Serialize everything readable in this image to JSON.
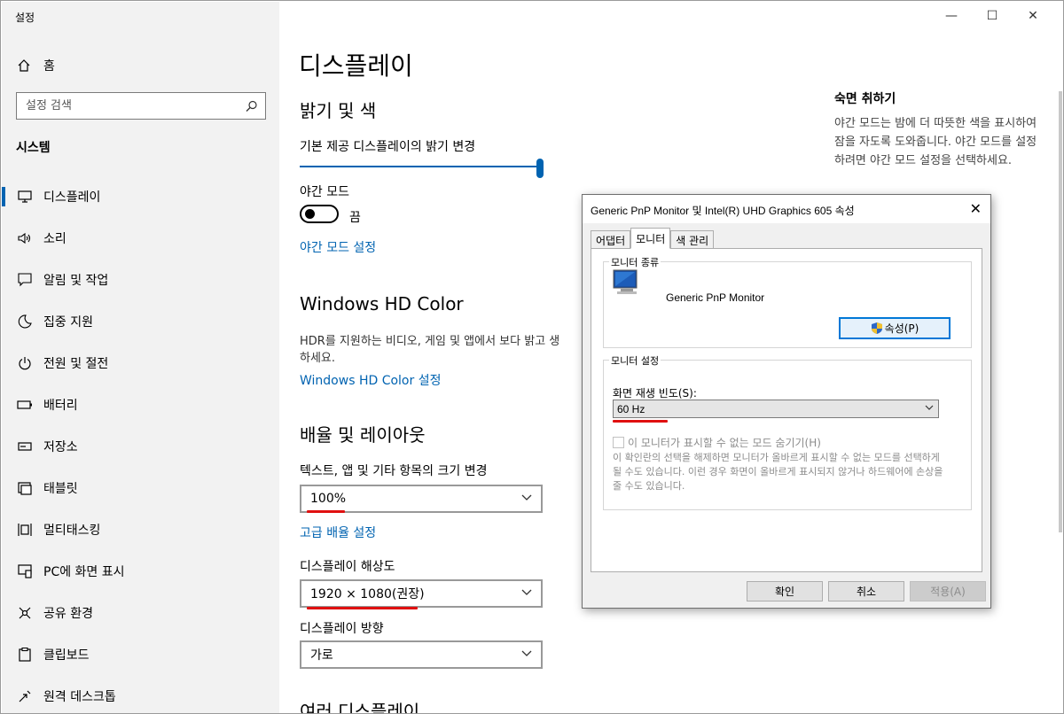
{
  "app": {
    "title": "설정"
  },
  "sidebar": {
    "home": "홈",
    "search_placeholder": "설정 검색",
    "section": "시스템",
    "items": [
      {
        "label": "디스플레이",
        "icon": "monitor-icon",
        "active": true
      },
      {
        "label": "소리",
        "icon": "speaker-icon"
      },
      {
        "label": "알림 및 작업",
        "icon": "notification-icon"
      },
      {
        "label": "집중 지원",
        "icon": "moon-icon"
      },
      {
        "label": "전원 및 절전",
        "icon": "power-icon"
      },
      {
        "label": "배터리",
        "icon": "battery-icon"
      },
      {
        "label": "저장소",
        "icon": "storage-icon"
      },
      {
        "label": "태블릿",
        "icon": "tablet-icon"
      },
      {
        "label": "멀티태스킹",
        "icon": "multitask-icon"
      },
      {
        "label": "PC에 화면 표시",
        "icon": "project-icon"
      },
      {
        "label": "공유 환경",
        "icon": "share-icon"
      },
      {
        "label": "클립보드",
        "icon": "clipboard-icon"
      },
      {
        "label": "원격 데스크톱",
        "icon": "remote-icon"
      }
    ]
  },
  "main": {
    "title": "디스플레이",
    "brightness_heading": "밝기 및 색",
    "brightness_label": "기본 제공 디스플레이의 밝기 변경",
    "brightness_value": 1.0,
    "night_mode_label": "야간 모드",
    "night_mode_state": "끔",
    "night_mode_link": "야간 모드 설정",
    "hdr_heading": "Windows HD Color",
    "hdr_desc": "HDR를 지원하는 비디오, 게임 및 앱에서 보다 밝고 생",
    "hdr_desc2": "하세요.",
    "hdr_link": "Windows HD Color 설정",
    "scale_heading": "배율 및 레이아웃",
    "scale_label": "텍스트, 앱 및 기타 항목의 크기 변경",
    "scale_value": "100%",
    "advanced_scale_link": "고급 배율 설정",
    "resolution_label": "디스플레이 해상도",
    "resolution_value": "1920 × 1080(권장)",
    "orientation_label": "디스플레이 방향",
    "orientation_value": "가로",
    "multi_heading": "여러 디스플레이"
  },
  "right": {
    "title": "숙면 취하기",
    "text": "야간 모드는 밤에 더 따뜻한 색을 표시하여 잠을 자도록 도와줍니다. 야간 모드를 설정하려면 야간 모드 설정을 선택하세요."
  },
  "dialog": {
    "title": "Generic PnP Monitor 및 Intel(R) UHD Graphics 605 속성",
    "tabs": [
      "어댑터",
      "모니터",
      "색 관리"
    ],
    "monitor_type_legend": "모니터 종류",
    "monitor_name": "Generic PnP Monitor",
    "properties_button": "속성(P)",
    "monitor_settings_legend": "모니터 설정",
    "refresh_label": "화면 재생 빈도(S):",
    "refresh_value": "60 Hz",
    "hide_modes_label": "이 모니터가 표시할 수 없는 모드 숨기기(H)",
    "note": "이 확인란의 선택을 해제하면 모니터가 올바르게 표시할 수 없는 모드를 선택하게 될 수도 있습니다. 이런 경우 화면이 올바르게 표시되지 않거나 하드웨어에 손상을 줄 수도 있습니다.",
    "ok": "확인",
    "cancel": "취소",
    "apply": "적용(A)"
  },
  "colors": {
    "accent": "#0063b1",
    "highlight": "#e01010"
  }
}
